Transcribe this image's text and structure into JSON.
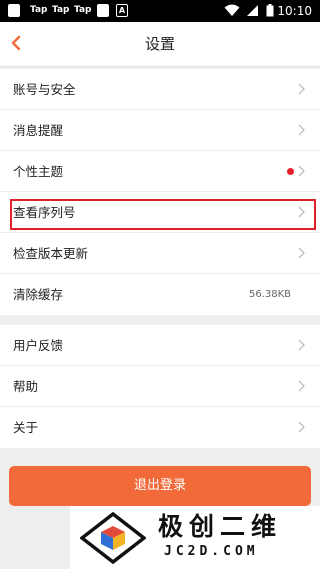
{
  "status_bar": {
    "notifications": [
      "Tap",
      "Tap",
      "Tap"
    ],
    "a_badge": "A",
    "time": "10:10",
    "icons": [
      "app-icon",
      "wifi-icon",
      "signal-icon",
      "battery-icon"
    ]
  },
  "header": {
    "back_icon": "chevron-left-icon",
    "title": "设置",
    "accent_color": "#f26a3a"
  },
  "groups": [
    {
      "items": [
        {
          "label": "账号与安全",
          "chevron": true
        },
        {
          "label": "消息提醒",
          "chevron": true
        },
        {
          "label": "个性主题",
          "chevron": true,
          "badge": "red-dot"
        },
        {
          "label": "查看序列号",
          "chevron": true,
          "highlighted": true
        },
        {
          "label": "检查版本更新",
          "chevron": true
        },
        {
          "label": "清除缓存",
          "value": "56.38KB"
        }
      ]
    },
    {
      "items": [
        {
          "label": "用户反馈",
          "chevron": true
        },
        {
          "label": "帮助",
          "chevron": true
        },
        {
          "label": "关于",
          "chevron": true
        }
      ]
    }
  ],
  "logout": {
    "label": "退出登录",
    "color": "#f26a3a"
  },
  "watermark": {
    "text_cn": "极创二维",
    "text_en": "JC2D.COM"
  }
}
